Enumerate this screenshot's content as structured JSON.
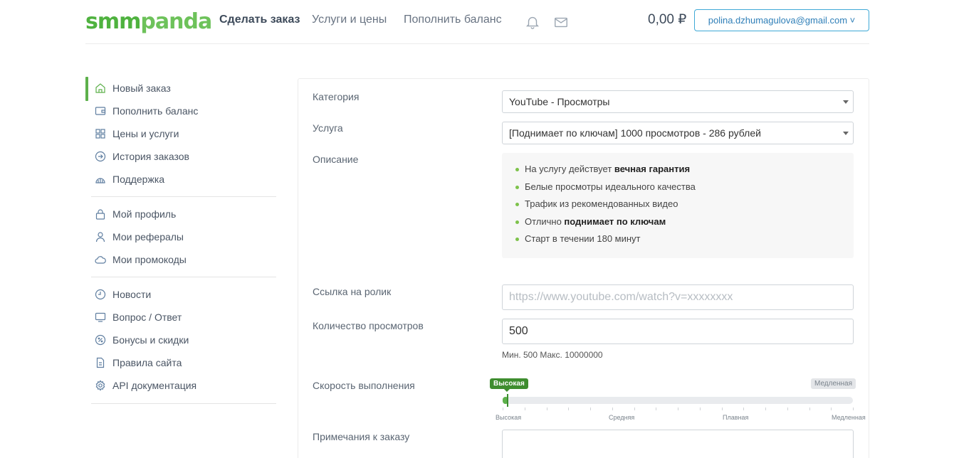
{
  "header": {
    "logo_smm": "smm",
    "logo_panda": "panda",
    "nav": [
      "Сделать заказ",
      "Услуги и цены",
      "Пополнить баланс"
    ],
    "balance": "0,00 ₽",
    "email": "polina.dzhumagulova@gmail.com ˅"
  },
  "sidebar": {
    "group1": [
      "Новый заказ",
      "Пополнить баланс",
      "Цены и услуги",
      "История заказов",
      "Поддержка"
    ],
    "group2": [
      "Мой профиль",
      "Мои рефералы",
      "Мои промокоды"
    ],
    "group3": [
      "Новости",
      "Вопрос / Ответ",
      "Бонусы и скидки",
      "Правила сайта",
      "API документация"
    ]
  },
  "form": {
    "category_label": "Категория",
    "category_value": "YouTube - Просмотры",
    "service_label": "Услуга",
    "service_value": "[Поднимает по ключам] 1000 просмотров - 286 рублей",
    "description_label": "Описание",
    "description": {
      "item1_pre": "На услугу действует ",
      "item1_bold": "вечная гарантия",
      "item2": "Белые просмотры идеального качества",
      "item3": "Трафик из рекомендованных видео",
      "item4_pre": "Отлично ",
      "item4_bold": "поднимает по ключам",
      "item5": "Старт в течении 180 минут"
    },
    "link_label": "Ссылка на ролик",
    "link_placeholder": "https://www.youtube.com/watch?v=xxxxxxxx",
    "quantity_label": "Количество просмотров",
    "quantity_value": "500",
    "quantity_hint": "Мин. 500 Макс. 10000000",
    "speed_label": "Скорость выполнения",
    "speed_tip_selected": "Высокая",
    "speed_tip_max": "Медленная",
    "speed_level": 0.01,
    "speed_ticks": [
      "Высокая",
      "Средняя",
      "Плавная",
      "Медленная"
    ],
    "notes_label": "Примечания к заказу"
  },
  "colors": {
    "brand_green": "#5db04b",
    "link_blue": "#2f7fb8"
  }
}
